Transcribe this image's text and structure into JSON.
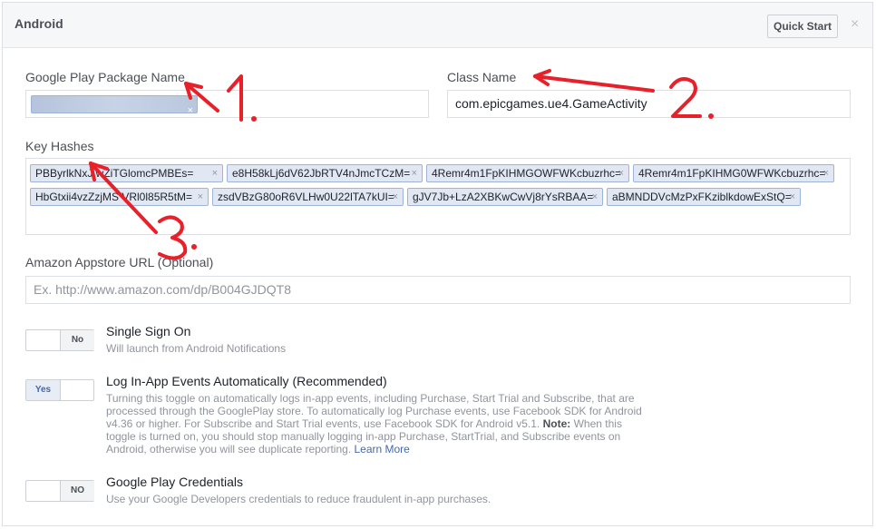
{
  "header": {
    "title": "Android",
    "quick_start_label": "Quick Start",
    "close_glyph": "×"
  },
  "package_name": {
    "label": "Google Play Package Name",
    "value_redacted": true
  },
  "class_name": {
    "label": "Class Name",
    "value": "com.epicgames.ue4.GameActivity"
  },
  "key_hashes": {
    "label": "Key Hashes",
    "tokens": [
      "PBByrlkNxJ   wZiTGlomcPMBEs=",
      "e8H58kLj6dV62JbRTV4nJmcTCzM=",
      "4Remr4m1FpKIHMGOWFWKcbuzrhc=",
      "4Remr4m1FpKIHMG0WFWKcbuzrhc=",
      "HbGtxii4vzZzjMS VRl0l85R5tM=",
      "zsdVBzG80oR6VLHw0U22lTA7kUI=",
      "gJV7Jb+LzA2XBKwCwVj8rYsRBAA=",
      "aBMNDDVcMzPxFKziblkdowExStQ="
    ]
  },
  "amazon": {
    "label": "Amazon Appstore URL (Optional)",
    "placeholder": "Ex. http://www.amazon.com/dp/B004GJDQT8"
  },
  "options": {
    "single_sign_on": {
      "title": "Single Sign On",
      "desc": "Will launch from Android Notifications",
      "toggle_label": "No",
      "enabled": false
    },
    "log_events": {
      "title": "Log In-App Events Automatically (Recommended)",
      "toggle_label": "Yes",
      "enabled": true,
      "desc_lines": [
        "Turning this toggle on automatically logs in-app events, including Purchase, Start Trial and Subscribe, that are",
        "processed through the GooglePlay store. To automatically log Purchase events, use Facebook SDK for Android",
        "v4.36 or higher. For Subscribe and Start Trial events, use Facebook SDK for Android v5.1. ",
        "toggle is turned on, you should stop manually logging in-app Purchase, StartTrial, and Subscribe events on",
        "Android, otherwise you will see duplicate reporting. "
      ],
      "note_label": "Note:",
      "note_tail": " When this",
      "learn_more": "Learn More"
    },
    "play_credentials": {
      "title": "Google Play Credentials",
      "desc": "Use your Google Developers credentials to reduce fraudulent in-app purchases.",
      "toggle_label": "NO",
      "enabled": false
    }
  },
  "annotations": {
    "one": "1.",
    "two": "2.",
    "three": "3.",
    "color": "#e8202a"
  }
}
